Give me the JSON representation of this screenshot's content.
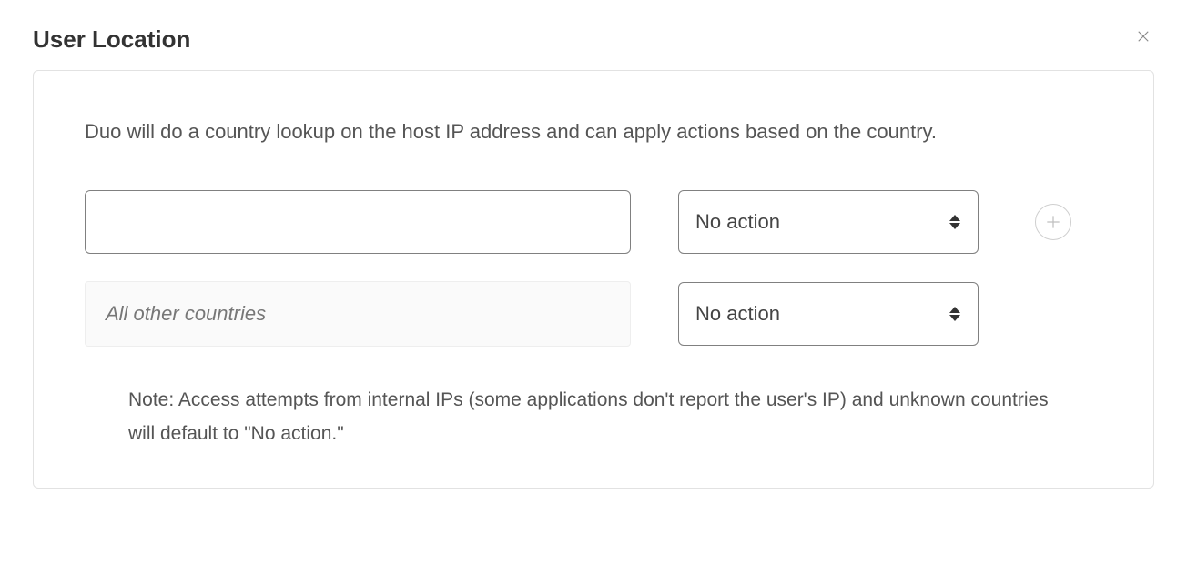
{
  "header": {
    "title": "User Location"
  },
  "panel": {
    "description": "Duo will do a country lookup on the host IP address and can apply actions based on the country.",
    "rows": [
      {
        "country_value": "",
        "action_selected": "No action"
      }
    ],
    "default_row": {
      "label": "All other countries",
      "action_selected": "No action"
    },
    "action_options": [
      "No action"
    ],
    "note": "Note: Access attempts from internal IPs (some applications don't report the user's IP) and unknown countries will default to \"No action.\""
  }
}
